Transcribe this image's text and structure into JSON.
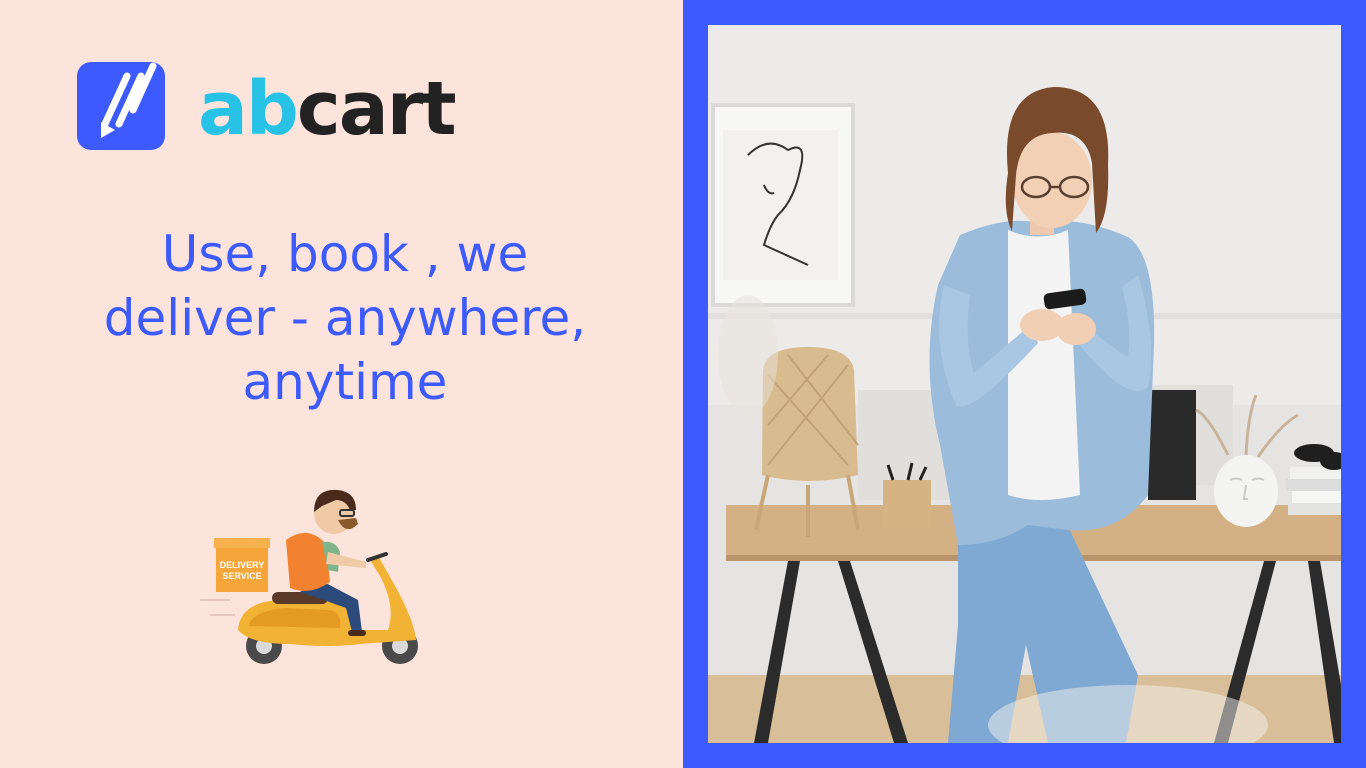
{
  "brand": {
    "name_part1": "ab",
    "name_part2": "cart",
    "color_primary": "#3d5afe",
    "color_accent": "#27c2e6",
    "color_dark": "#222222",
    "logo_icon": "pencil-play-icon"
  },
  "hero": {
    "tagline_line1": "Use, book , we",
    "tagline_line2": "deliver - anywhere,",
    "tagline_line3": "anytime"
  },
  "illustration": {
    "box_label_line1": "DELIVERY",
    "box_label_line2": "SERVICE",
    "icon": "delivery-scooter-icon"
  },
  "photo": {
    "subject": "woman-using-phone-photo",
    "frame_color": "#3d5afe"
  },
  "background_color": "#fce4dc"
}
